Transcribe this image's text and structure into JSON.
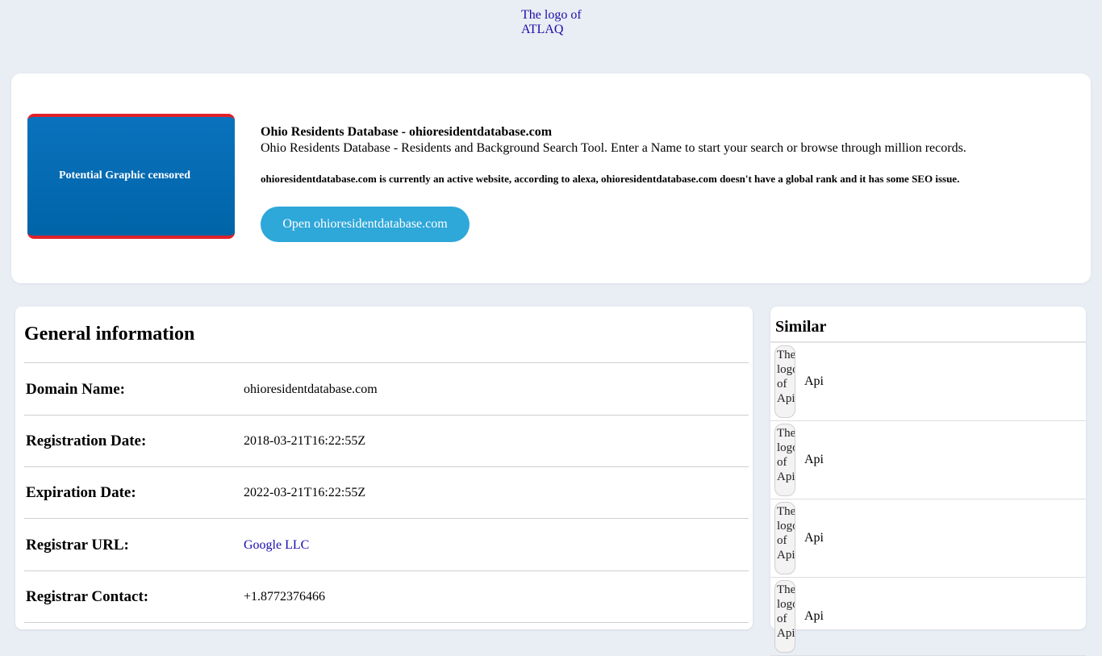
{
  "header": {
    "logo_alt": "The logo of ATLAQ"
  },
  "hero": {
    "thumb_text": "Potential Graphic censored",
    "title": "Ohio Residents Database - ohioresidentdatabase.com",
    "description": "Ohio Residents Database - Residents and Background Search Tool. Enter a Name to start your search or browse through million records.",
    "note": "ohioresidentdatabase.com is currently an active website, according to alexa, ohioresidentdatabase.com doesn't have a global rank and it has some SEO issue.",
    "open_label": "Open ohioresidentdatabase.com"
  },
  "general": {
    "title": "General information",
    "rows": [
      {
        "label": "Domain Name:",
        "value": "ohioresidentdatabase.com"
      },
      {
        "label": "Registration Date:",
        "value": "2018-03-21T16:22:55Z"
      },
      {
        "label": "Expiration Date:",
        "value": "2022-03-21T16:22:55Z"
      },
      {
        "label": "Registrar URL:",
        "value": "Google LLC"
      },
      {
        "label": "Registrar Contact:",
        "value": "+1.8772376466"
      }
    ]
  },
  "similar": {
    "title": "Similar",
    "items": [
      {
        "img_alt": "The logo of Api",
        "name": "Api"
      },
      {
        "img_alt": "The logo of Api",
        "name": "Api"
      },
      {
        "img_alt": "The logo of Api",
        "name": "Api"
      },
      {
        "img_alt": "The logo of Api",
        "name": "Api"
      }
    ]
  }
}
